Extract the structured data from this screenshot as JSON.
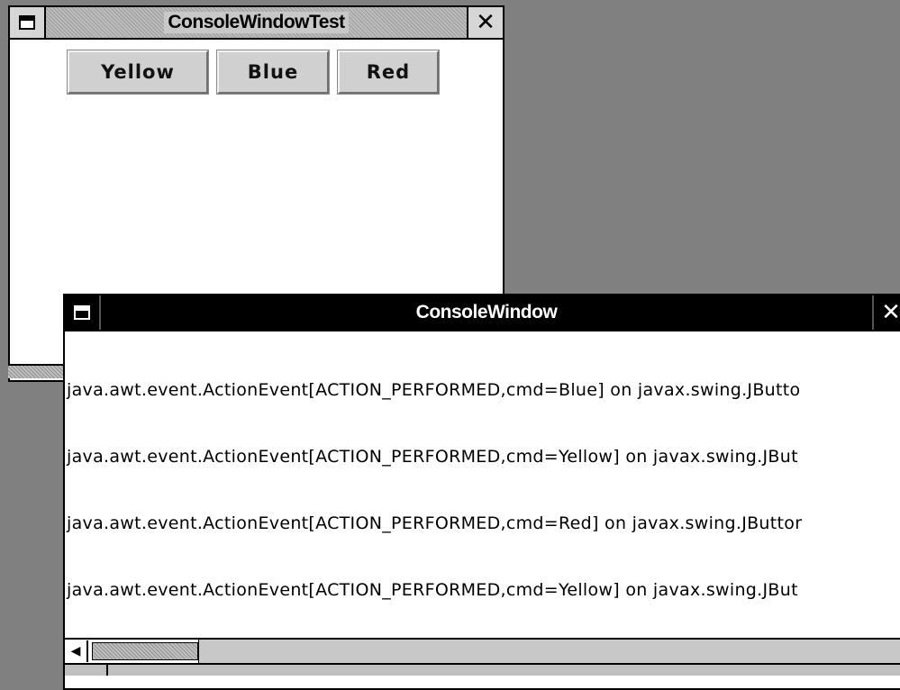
{
  "windows": {
    "back": {
      "title": "ConsoleWindowTest",
      "buttons": [
        {
          "label": "Yellow"
        },
        {
          "label": "Blue"
        },
        {
          "label": "Red"
        }
      ]
    },
    "console": {
      "title": "ConsoleWindow",
      "lines": [
        "java.awt.event.ActionEvent[ACTION_PERFORMED,cmd=Blue] on javax.swing.JButto",
        "java.awt.event.ActionEvent[ACTION_PERFORMED,cmd=Yellow] on javax.swing.JBut",
        "java.awt.event.ActionEvent[ACTION_PERFORMED,cmd=Red] on javax.swing.JButtor",
        "java.awt.event.ActionEvent[ACTION_PERFORMED,cmd=Yellow] on javax.swing.JBut"
      ]
    }
  },
  "icons": {
    "window_menu": "window-menu-icon",
    "close": "close-icon",
    "scroll_left": "arrow-left-icon",
    "scroll_right": "arrow-right-icon"
  },
  "colors": {
    "desktop": "#808080",
    "console_titlebar": "#000000",
    "button_face": "#d0d0d0"
  }
}
